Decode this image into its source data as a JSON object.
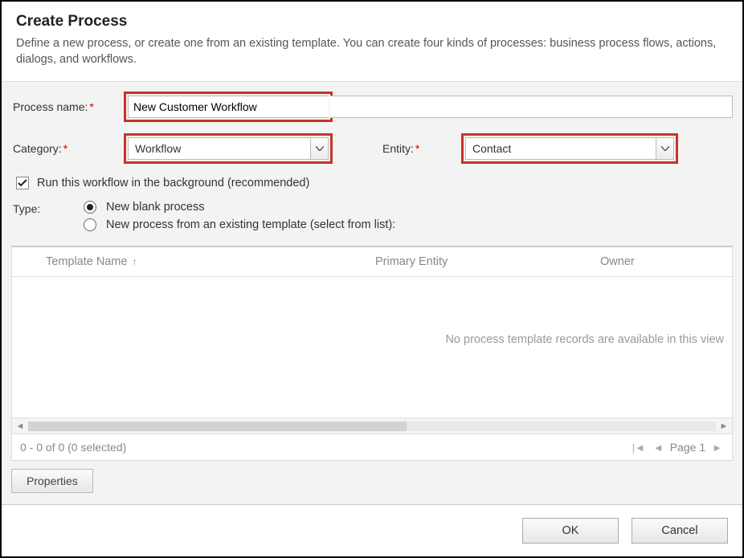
{
  "header": {
    "title": "Create Process",
    "subtitle": "Define a new process, or create one from an existing template. You can create four kinds of processes: business process flows, actions, dialogs, and workflows."
  },
  "form": {
    "process_name_label": "Process name:",
    "process_name_value": "New Customer Workflow",
    "category_label": "Category:",
    "category_value": "Workflow",
    "entity_label": "Entity:",
    "entity_value": "Contact",
    "run_background_label": "Run this workflow in the background (recommended)",
    "run_background_checked": true,
    "type_label": "Type:",
    "type_options": [
      {
        "label": "New blank process",
        "checked": true
      },
      {
        "label": "New process from an existing template (select from list):",
        "checked": false
      }
    ]
  },
  "grid": {
    "columns": {
      "template_name": "Template Name",
      "primary_entity": "Primary Entity",
      "owner": "Owner"
    },
    "sort_indicator": "↑",
    "empty_message": "No process template records are available in this view",
    "pager_status": "0 - 0 of 0 (0 selected)",
    "pager_page_label": "Page 1"
  },
  "buttons": {
    "properties": "Properties",
    "ok": "OK",
    "cancel": "Cancel"
  }
}
